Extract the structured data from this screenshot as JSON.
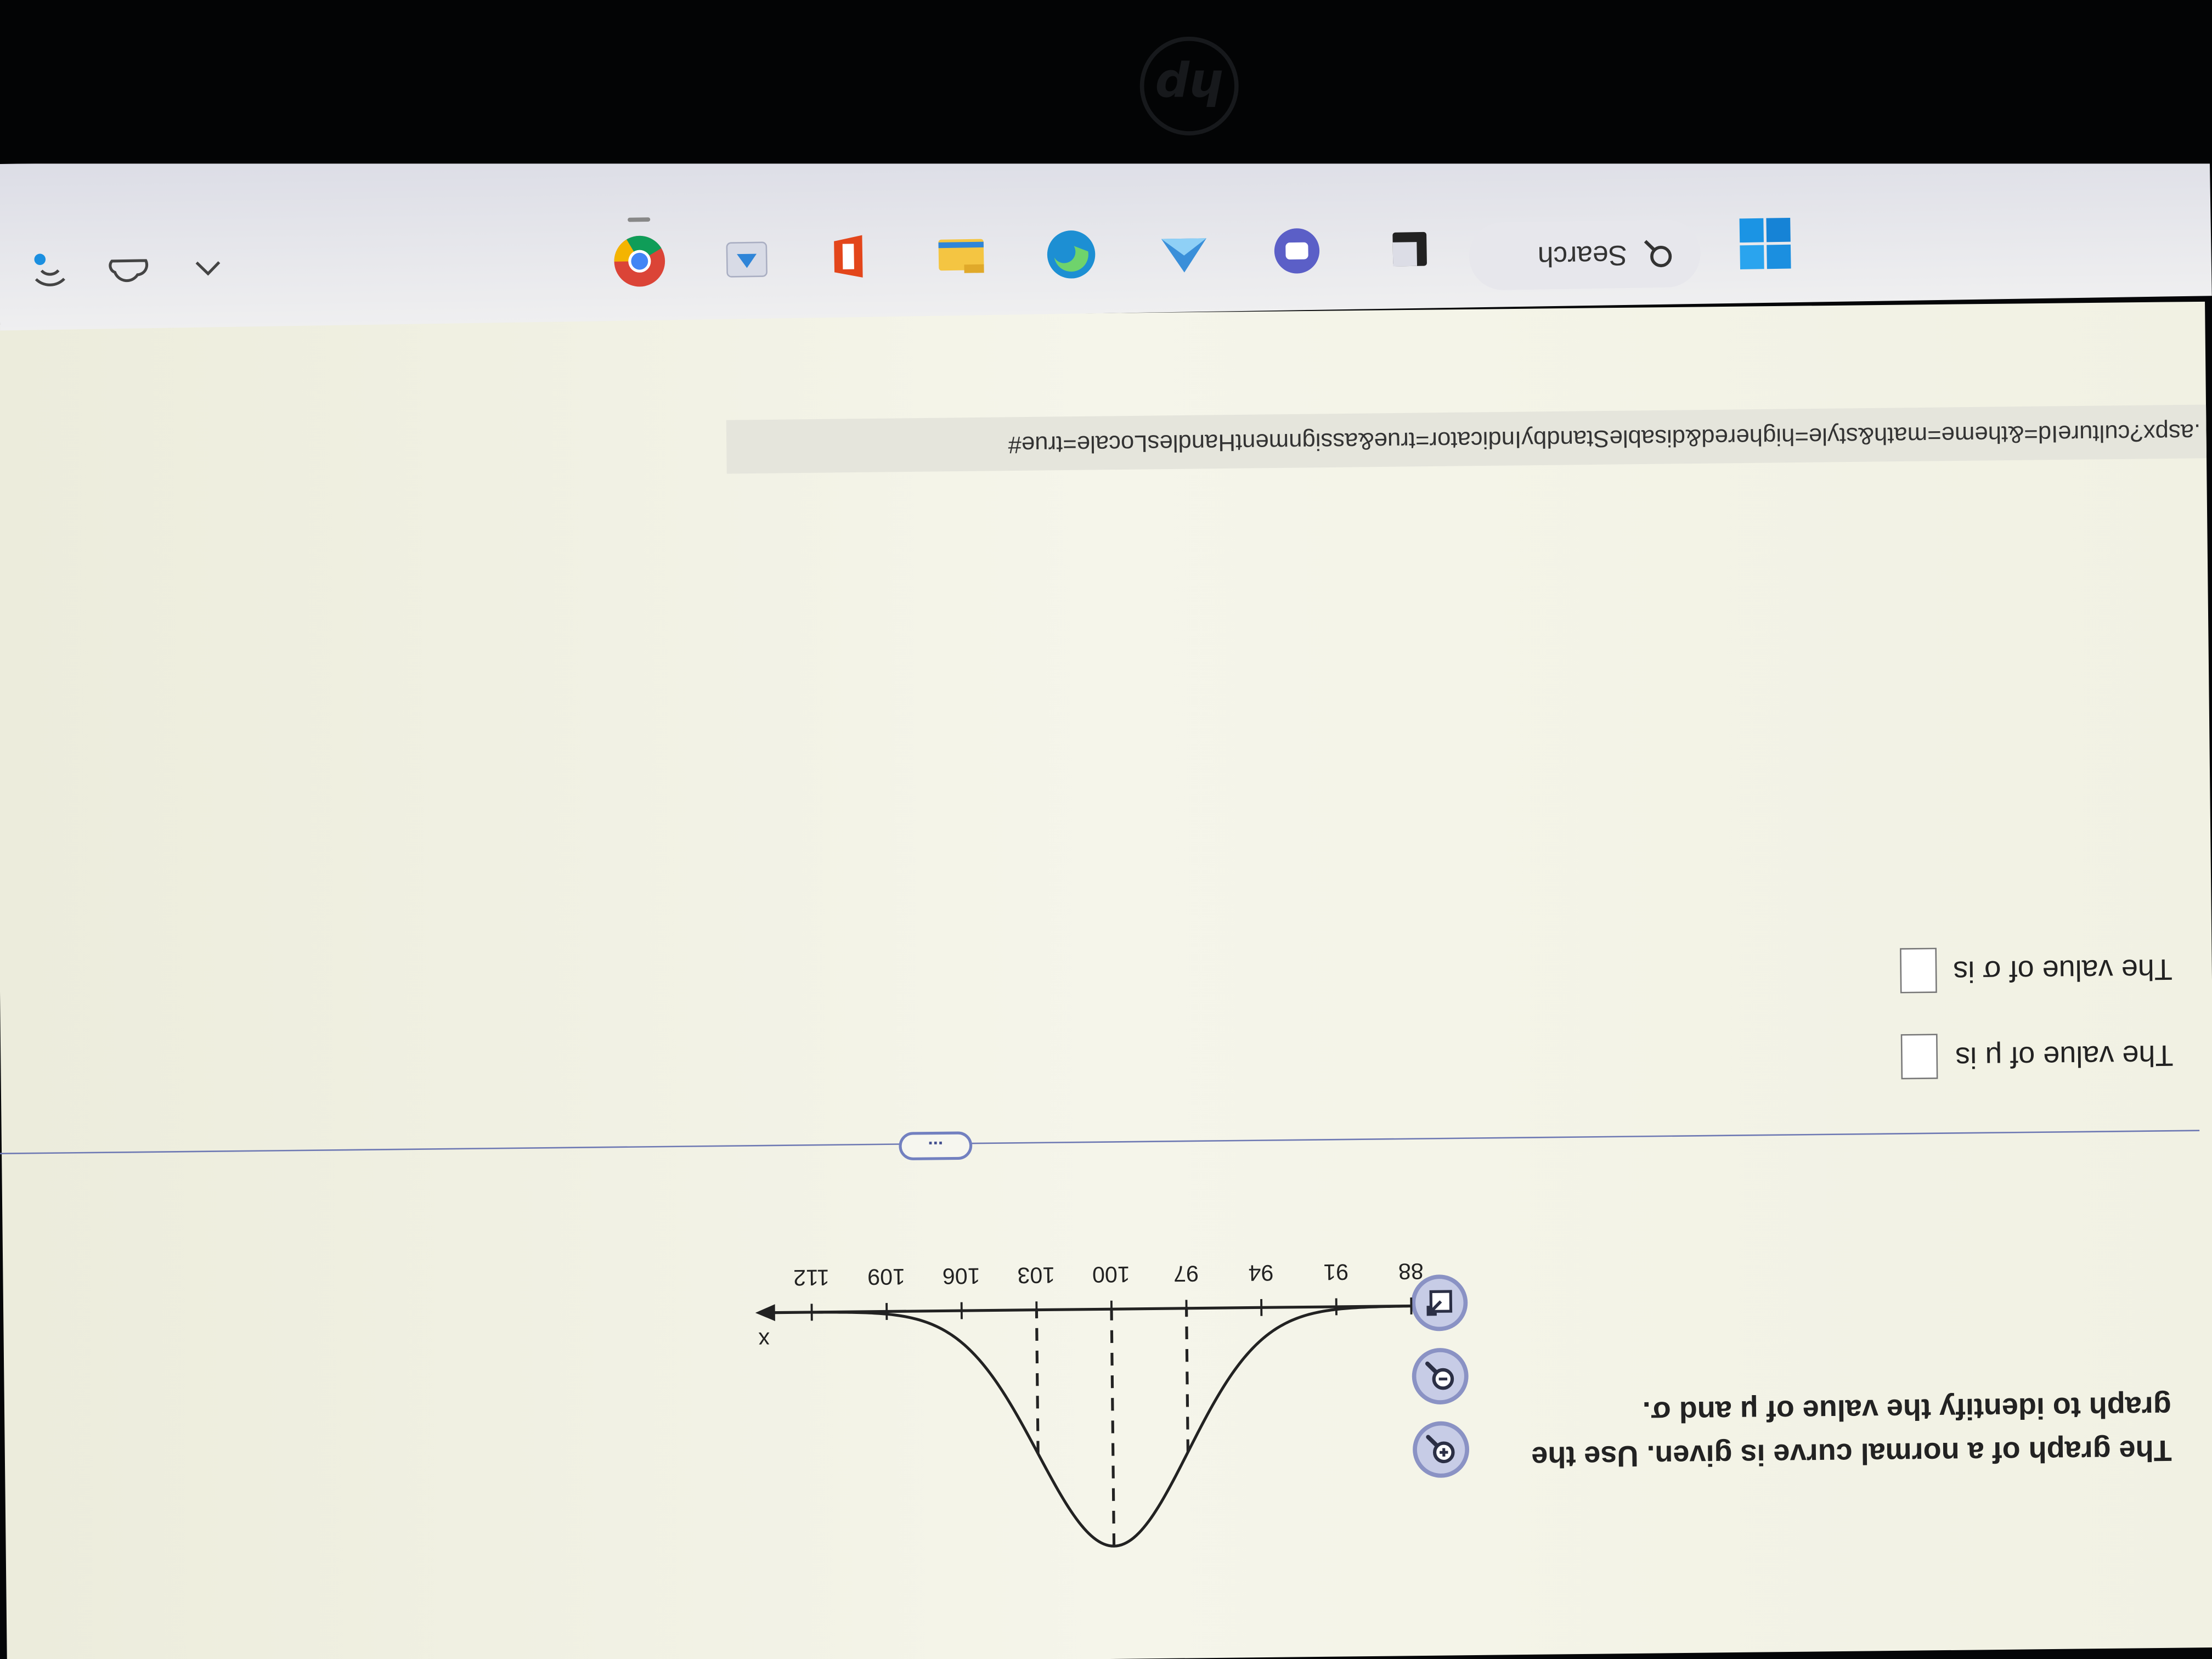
{
  "question": {
    "text": "The graph of a normal curve is given. Use the graph to identify the value of μ and σ."
  },
  "toolbar": {
    "zoom_in_icon": "zoom-in-icon",
    "zoom_out_icon": "zoom-out-icon",
    "popout_icon": "popout-icon"
  },
  "chart_data": {
    "type": "line",
    "title": "",
    "xlabel": "x",
    "ylabel": "",
    "x_ticks": [
      88,
      91,
      94,
      97,
      100,
      103,
      106,
      109,
      112
    ],
    "mean": 100,
    "std_dev": 3,
    "dashed_lines_at": [
      97,
      100,
      103
    ],
    "grid": false
  },
  "divider": {
    "label": "..."
  },
  "answers": {
    "mu_label": "The value of μ is",
    "mu_value": "",
    "sigma_label": "The value of σ is",
    "sigma_value": ""
  },
  "browser": {
    "url_fragment": ".aspx?cultureId=&theme=math&style=highered&disableStandbyIndicator=true&assignmentHandlesLocale=true#"
  },
  "taskbar": {
    "search_label": "Search",
    "icons": [
      "windows-start-icon",
      "search-icon",
      "task-view-icon",
      "teams-icon",
      "widgets-icon",
      "edge-icon",
      "file-explorer-icon",
      "office-icon",
      "store-icon",
      "chrome-icon"
    ],
    "tray_icons": [
      "chevron-up-icon",
      "onedrive-icon",
      "network-icon"
    ]
  },
  "device": {
    "logo": "hp"
  }
}
